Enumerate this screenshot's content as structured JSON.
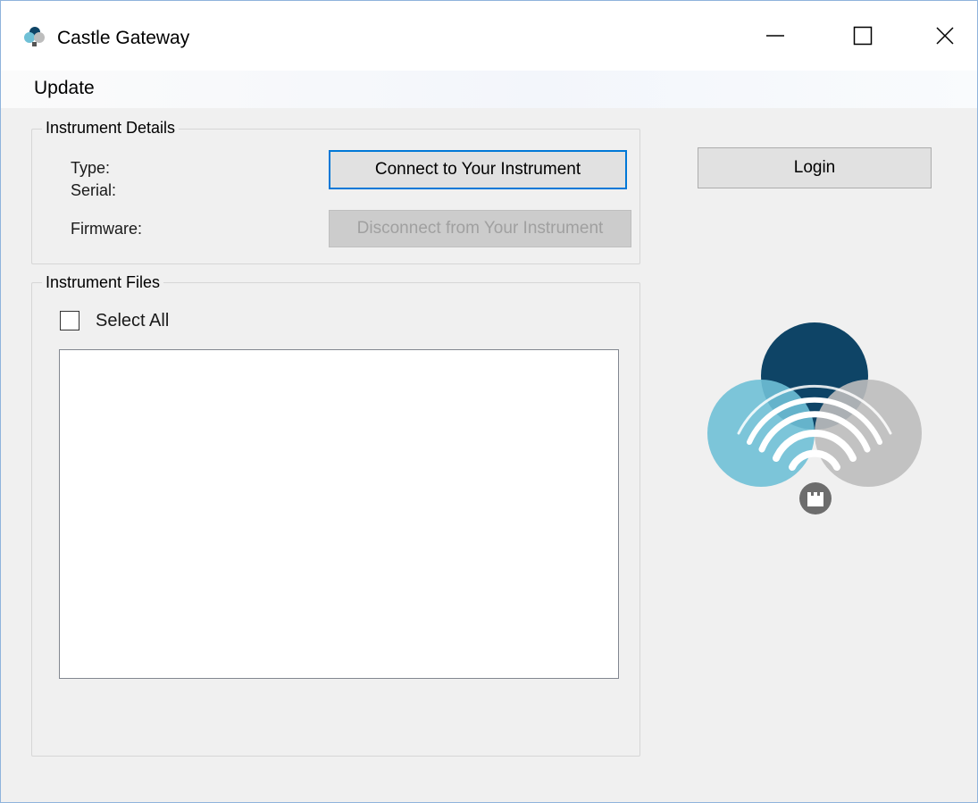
{
  "window": {
    "title": "Castle Gateway",
    "controls": {
      "minimize_icon": "minimize-icon",
      "maximize_icon": "maximize-icon",
      "close_icon": "close-icon"
    }
  },
  "menu": {
    "items": [
      "Update"
    ]
  },
  "instrument_details": {
    "legend": "Instrument Details",
    "type_label": "Type:",
    "serial_label": "Serial:",
    "firmware_label": "Firmware:",
    "connect_button": "Connect to Your Instrument",
    "disconnect_button": "Disconnect from Your Instrument"
  },
  "login_button": "Login",
  "instrument_files": {
    "legend": "Instrument Files",
    "select_all_label": "Select All",
    "select_all_checked": false,
    "files": []
  },
  "colors": {
    "logo_dark_blue": "#0e4466",
    "logo_light_blue": "#6fc0d6",
    "logo_gray": "#bdbdbd",
    "focus_border": "#0078d7"
  }
}
